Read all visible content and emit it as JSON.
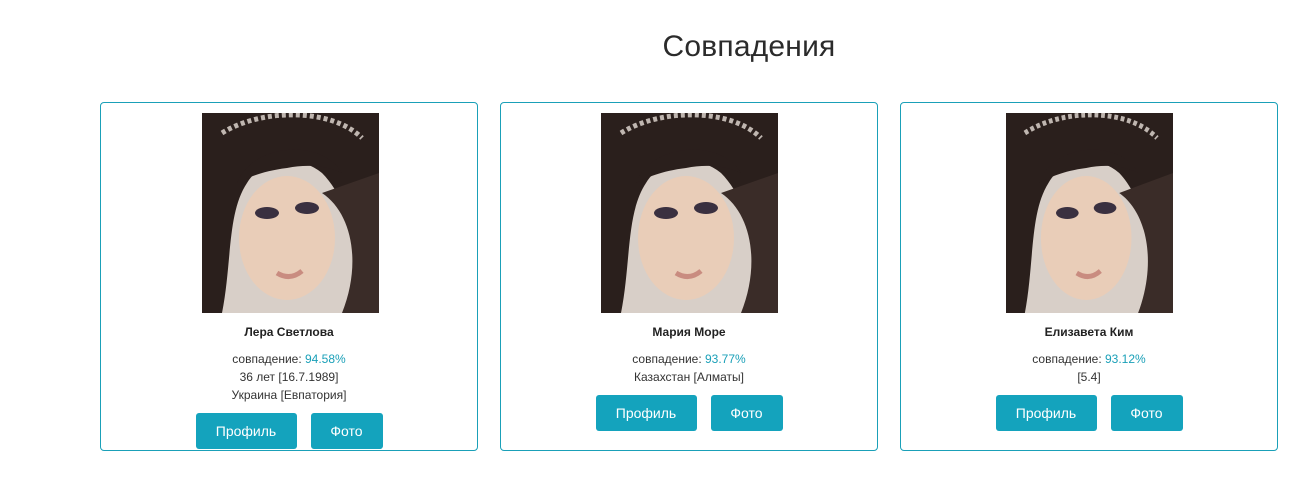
{
  "page": {
    "title": "Совпадения"
  },
  "labels": {
    "match_prefix": "совпадение: ",
    "profile_button": "Профиль",
    "photo_button": "Фото"
  },
  "colors": {
    "accent": "#14a3bd",
    "border": "#1aa0b8"
  },
  "cards": [
    {
      "name": "Лера Светлова",
      "match": "94.58%",
      "age_line": "36 лет [16.7.1989]",
      "location": "Украина [Евпатория]"
    },
    {
      "name": "Мария Море",
      "match": "93.77%",
      "location": "Казахстан [Алматы]"
    },
    {
      "name": "Елизавета Ким",
      "match": "93.12%",
      "location": "[5.4]"
    }
  ]
}
